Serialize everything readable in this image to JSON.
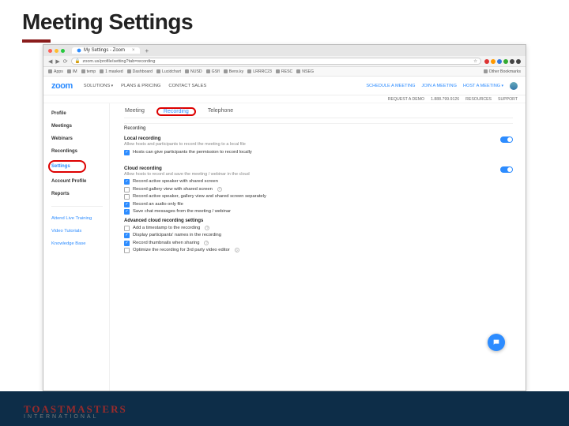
{
  "slide": {
    "title": "Meeting Settings"
  },
  "browser": {
    "tab_title": "My Settings - Zoom",
    "url": "zoom.us/profile/setting?tab=recording",
    "bookmarks": [
      "Apps",
      "IM",
      "temp",
      "1 masked",
      "Dashboard",
      "Lucidchart",
      "NUSD",
      "GSfl",
      "Bens.ky",
      "LRRRC23",
      "RESC",
      "NSEG"
    ],
    "bookmarks_right": "Other Bookmarks"
  },
  "zoom": {
    "logo": "zoom",
    "nav": {
      "solutions": "Solutions",
      "plans": "Plans & Pricing",
      "contact": "Contact Sales"
    },
    "right": {
      "req": "Request a Demo",
      "phone": "1.888.799.9126",
      "res": "Resources",
      "sup": "Support",
      "sched": "Schedule a Meeting",
      "join": "Join a Meeting",
      "host": "Host a Meeting"
    },
    "sidebar": {
      "items": [
        "Profile",
        "Meetings",
        "Webinars",
        "Recordings",
        "Settings",
        "Account Profile",
        "Reports"
      ],
      "help": [
        "Attend Live Training",
        "Video Tutorials",
        "Knowledge Base"
      ]
    },
    "tabs": {
      "meeting": "Meeting",
      "recording": "Recording",
      "telephone": "Telephone"
    },
    "section1": "Recording",
    "local": {
      "title": "Local recording",
      "sub": "Allow hosts and participants to record the meeting to a local file",
      "hosts_give": "Hosts can give participants the permission to record locally"
    },
    "cloud": {
      "title": "Cloud recording",
      "sub": "Allow hosts to record and save the meeting / webinar in the cloud",
      "o1": "Record active speaker with shared screen",
      "o2": "Record gallery view with shared screen",
      "o3": "Record active speaker, gallery view and shared screen separately",
      "o4": "Record an audio only file",
      "o5": "Save chat messages from the meeting / webinar"
    },
    "adv": {
      "title": "Advanced cloud recording settings",
      "o1": "Add a timestamp to the recording",
      "o2": "Display participants' names in the recording",
      "o3": "Record thumbnails when sharing",
      "o4": "Optimize the recording for 3rd party video editor"
    }
  },
  "footer": {
    "brand_big": "TOASTMASTERS",
    "brand_small": "INTERNATIONAL"
  }
}
